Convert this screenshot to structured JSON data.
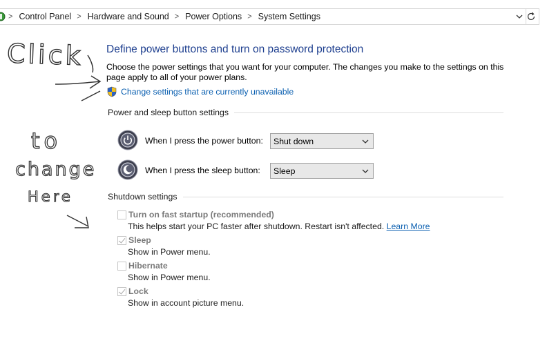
{
  "breadcrumb": {
    "items": [
      "Control Panel",
      "Hardware and Sound",
      "Power Options",
      "System Settings"
    ],
    "separator": ">"
  },
  "annotation": {
    "line1": "Click",
    "line2": "to",
    "line3": "change",
    "line4": "Here"
  },
  "main": {
    "title": "Define power buttons and turn on password protection",
    "description": "Choose the power settings that you want for your computer. The changes you make to the settings on this page apply to all of your power plans.",
    "change_link": "Change settings that are currently unavailable"
  },
  "power_section": {
    "label": "Power and sleep button settings",
    "power_button": {
      "label": "When I press the power button:",
      "value": "Shut down"
    },
    "sleep_button": {
      "label": "When I press the sleep button:",
      "value": "Sleep"
    }
  },
  "shutdown_section": {
    "label": "Shutdown settings",
    "options": [
      {
        "label": "Turn on fast startup (recommended)",
        "desc": "This helps start your PC faster after shutdown. Restart isn't affected.",
        "link": "Learn More",
        "checked": false
      },
      {
        "label": "Sleep",
        "desc": "Show in Power menu.",
        "checked": true
      },
      {
        "label": "Hibernate",
        "desc": "Show in Power menu.",
        "checked": false
      },
      {
        "label": "Lock",
        "desc": "Show in account picture menu.",
        "checked": true
      }
    ]
  },
  "colors": {
    "title": "#1e3f8f",
    "link": "#0a5fb0",
    "disabled_label": "#7a7a7a"
  }
}
